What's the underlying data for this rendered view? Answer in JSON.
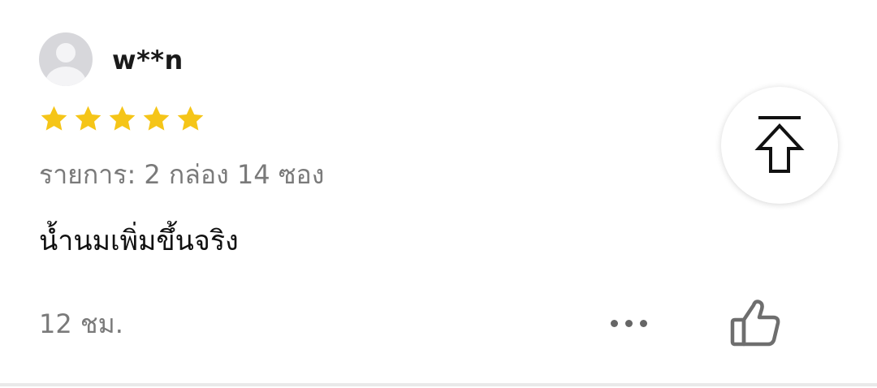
{
  "review": {
    "username": "w**n",
    "rating": 5,
    "rating_max": 5,
    "item_info": "รายการ: 2 กล่อง 14 ซอง",
    "text": "น้ำนมเพิ่มขึ้นจริง",
    "time": "12 ชม."
  },
  "icons": {
    "avatar": "default-avatar-icon",
    "star": "star-icon",
    "more": "more-options-icon",
    "like": "thumbs-up-icon",
    "back_to_top": "back-to-top-icon"
  },
  "colors": {
    "star": "#f5c518",
    "secondary_text": "#7a7a7a",
    "primary_text": "#111111"
  }
}
